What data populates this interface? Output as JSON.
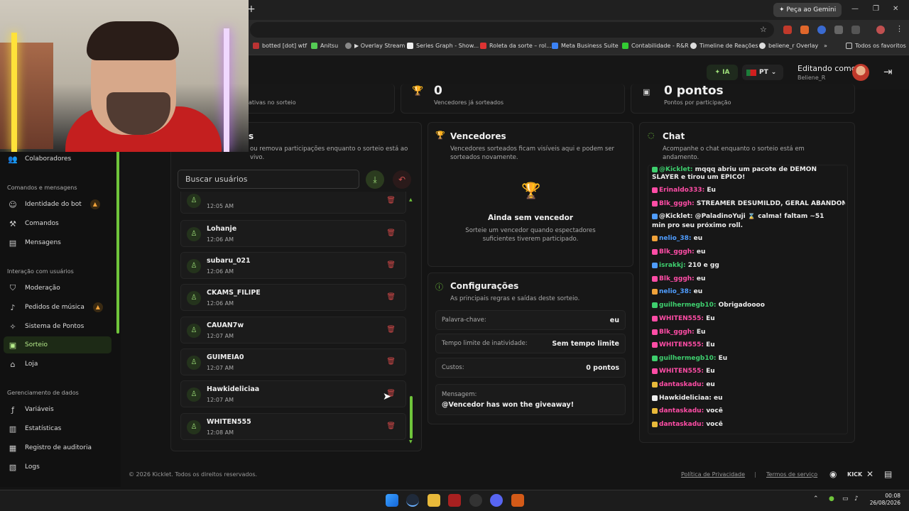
{
  "browser": {
    "gemini_label": "Peça ao Gemini",
    "bookmarks": [
      "botted [dot] wtf",
      "Anitsu",
      "▶ Overlay Stream",
      "Series Graph - Show...",
      "Roleta da sorte – rol...",
      "Meta Business Suite",
      "Contabilidade - R&R",
      "Timeline de Reações",
      "beliene_r Overlay"
    ],
    "all_favorites": "Todos os favoritos"
  },
  "header": {
    "ia_label": "IA",
    "lang_label": "PT",
    "editing_label": "Editando como",
    "editing_user": "Beliene_R"
  },
  "sidebar": {
    "item_collab": "Colaboradores",
    "sec_commands": "Comandos e mensagens",
    "item_bot": "Identidade do bot",
    "item_commands": "Comandos",
    "item_messages": "Mensagens",
    "sec_interaction": "Interação com usuários",
    "item_moderation": "Moderação",
    "item_music": "Pedidos de música",
    "item_points": "Sistema de Pontos",
    "item_raffle": "Sorteio",
    "item_store": "Loja",
    "sec_data": "Gerenciamento de dados",
    "item_vars": "Variáveis",
    "item_stats": "Estatísticas",
    "item_audit": "Registro de auditoria",
    "item_logs": "Logs"
  },
  "stats": {
    "participants_label": "ativas no sorteio",
    "winners_value": "0",
    "winners_label": "Vencedores já sorteados",
    "points_value": "0 pontos",
    "points_label": "Pontos por participação"
  },
  "participants": {
    "title_tail": "s",
    "subtitle": "ou remova participações enquanto o sorteio está ao vivo.",
    "search_placeholder": "Buscar usuários",
    "partial_time": "12:05 AM",
    "rows": [
      {
        "name": "Lohanje",
        "time": "12:06 AM"
      },
      {
        "name": "subaru_021",
        "time": "12:06 AM"
      },
      {
        "name": "CKAMS_FILIPE",
        "time": "12:06 AM"
      },
      {
        "name": "CAUAN7w",
        "time": "12:07 AM"
      },
      {
        "name": "GUIMEIA0",
        "time": "12:07 AM"
      },
      {
        "name": "Hawkideliciaa",
        "time": "12:07 AM"
      },
      {
        "name": "WHITEN555",
        "time": "12:08 AM"
      }
    ]
  },
  "winners": {
    "title": "Vencedores",
    "subtitle": "Vencedores sorteados ficam visíveis aqui e podem ser sorteados novamente.",
    "empty_title": "Ainda sem vencedor",
    "empty_text": "Sorteie um vencedor quando espectadores suficientes tiverem participado."
  },
  "config": {
    "title": "Configurações",
    "subtitle": "As principais regras e saídas deste sorteio.",
    "keyword_label": "Palavra-chave:",
    "keyword_value": "eu",
    "timeout_label": "Tempo limite de inatividade:",
    "timeout_value": "Sem tempo limite",
    "cost_label": "Custos:",
    "cost_value": "0 pontos",
    "message_label": "Mensagem:",
    "message_value": "@Vencedor has won the giveaway!"
  },
  "chat": {
    "title": "Chat",
    "subtitle": "Acompanhe o chat enquanto o sorteio está em andamento.",
    "lines": [
      {
        "user": "@Kicklet:",
        "color": "#3ecf6e",
        "text": "mqqq abriu um pacote de DEMON"
      },
      {
        "user": "",
        "color": "#eee",
        "text": "SLAYER e tirou um ÉPICO!"
      },
      {
        "user": "Erinaldo333:",
        "color": "#ff4da6",
        "text": "Eu"
      },
      {
        "user": "Blk_gggh:",
        "color": "#ff4da6",
        "text": "STREAMER DESUMILDD, GERAL ABANDONA"
      },
      {
        "user": "@Kicklet:",
        "color": "#eee",
        "text": "@PaladinoYuji ⌛ calma! faltam ~51"
      },
      {
        "user": "",
        "color": "#eee",
        "text": "min pro seu próximo roll."
      },
      {
        "user": "nelio_38:",
        "color": "#4f9dff",
        "text": "eu"
      },
      {
        "user": "Blk_gggh:",
        "color": "#ff4da6",
        "text": "eu"
      },
      {
        "user": "israkkj:",
        "color": "#3ecf6e",
        "text": "210 e gg"
      },
      {
        "user": "Blk_gggh:",
        "color": "#ff4da6",
        "text": "eu"
      },
      {
        "user": "nelio_38:",
        "color": "#4f9dff",
        "text": "eu"
      },
      {
        "user": "guilhermegb10:",
        "color": "#3ecf6e",
        "text": "Obrigadoooo"
      },
      {
        "user": "WHITEN555:",
        "color": "#ff4da6",
        "text": "Eu"
      },
      {
        "user": "Blk_gggh:",
        "color": "#ff4da6",
        "text": "Eu"
      },
      {
        "user": "WHITEN555:",
        "color": "#ff4da6",
        "text": "Eu"
      },
      {
        "user": "guilhermegb10:",
        "color": "#3ecf6e",
        "text": "Eu"
      },
      {
        "user": "WHITEN555:",
        "color": "#ff4da6",
        "text": "Eu"
      },
      {
        "user": "dantaskadu:",
        "color": "#ff4da6",
        "text": "eu"
      },
      {
        "user": "Hawkideliciaa:",
        "color": "#eee",
        "text": "eu"
      },
      {
        "user": "dantaskadu:",
        "color": "#ff4da6",
        "text": "você"
      },
      {
        "user": "dantaskadu:",
        "color": "#ff4da6",
        "text": "você"
      }
    ]
  },
  "footer": {
    "copyright": "© 2026 Kicklet. Todos os direitos reservados.",
    "privacy": "Política de Privacidade",
    "separator": "|",
    "terms": "Termos de serviço",
    "kick_label": "KICK"
  },
  "taskbar": {
    "time": "00:08",
    "date": "26/08/2026"
  },
  "colors": {
    "accent": "#6fc43b",
    "danger": "#d04848",
    "background": "#141414"
  }
}
